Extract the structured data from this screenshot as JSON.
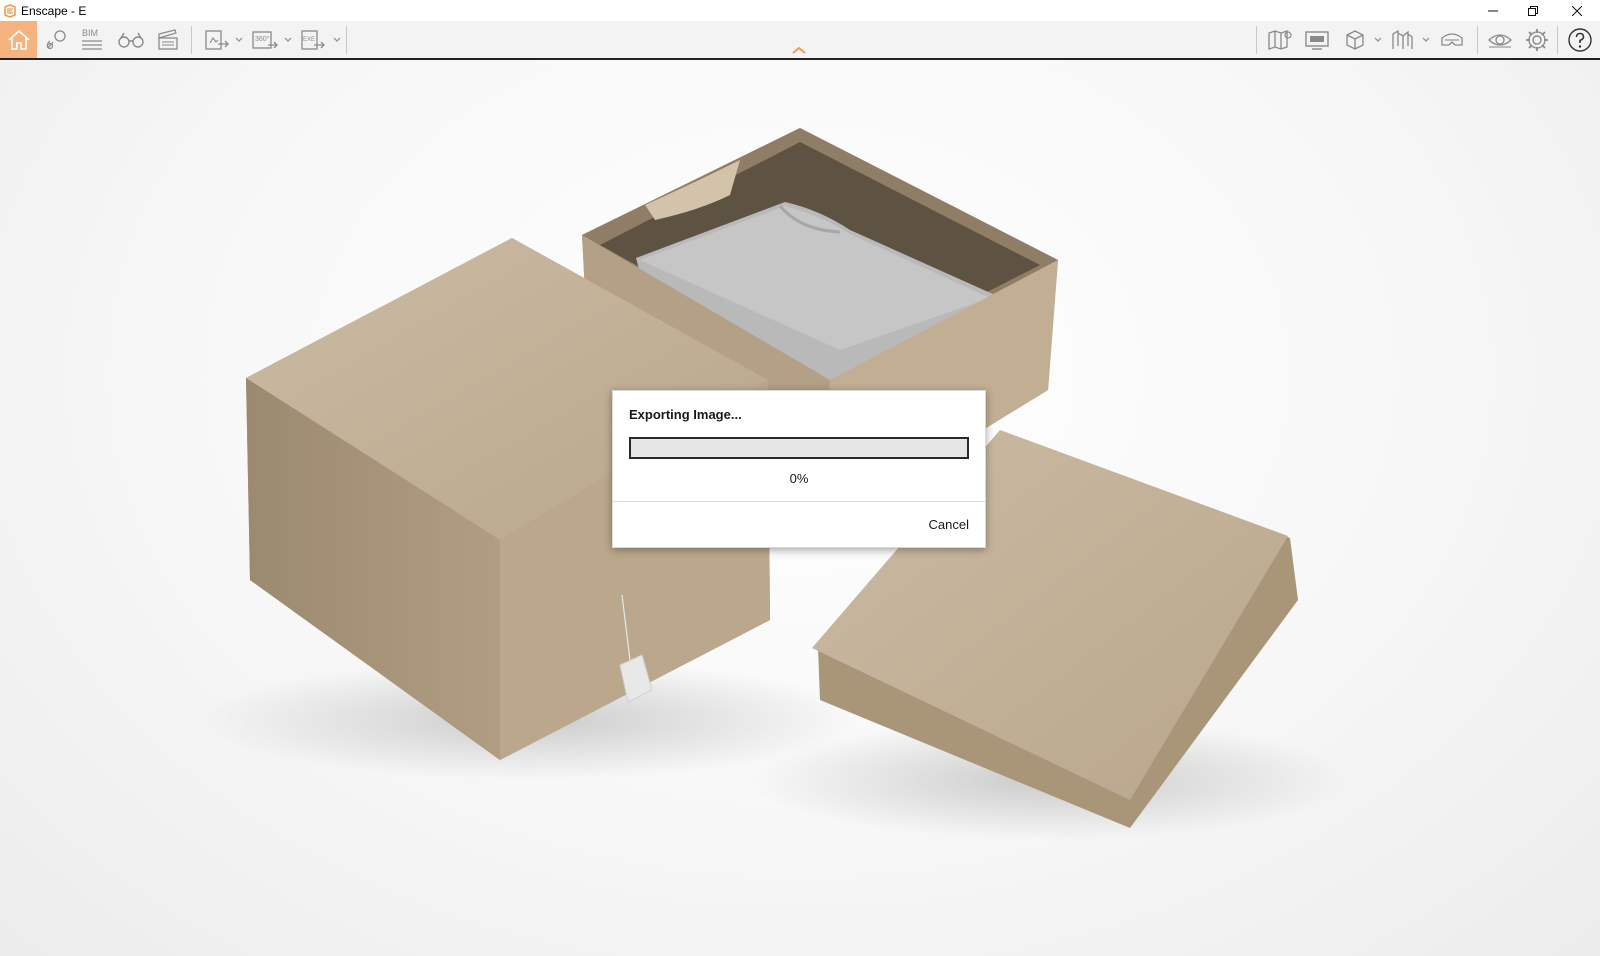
{
  "window": {
    "title": "Enscape - E",
    "accent_color": "#f29a4a"
  },
  "toolbar": {
    "left_buttons": [
      {
        "name": "home-icon",
        "label": ""
      },
      {
        "name": "location-pin-icon",
        "label": ""
      },
      {
        "name": "bim-icon",
        "label": "BIM"
      },
      {
        "name": "binoculars-icon",
        "label": ""
      },
      {
        "name": "clapperboard-icon",
        "label": ""
      },
      {
        "name": "screenshot-export-icon",
        "label": ""
      },
      {
        "name": "panorama-export-icon",
        "label": "360°"
      },
      {
        "name": "exe-export-icon",
        "label": "EXE"
      }
    ],
    "right_buttons": [
      "map-icon",
      "monitor-icon",
      "box-view-icon",
      "sketch-mode-icon",
      "vr-headset-icon",
      "eye-icon",
      "gear-icon",
      "help-icon"
    ]
  },
  "dialog": {
    "title": "Exporting Image...",
    "progress": 0,
    "progress_text": "0%",
    "cancel_label": "Cancel"
  }
}
